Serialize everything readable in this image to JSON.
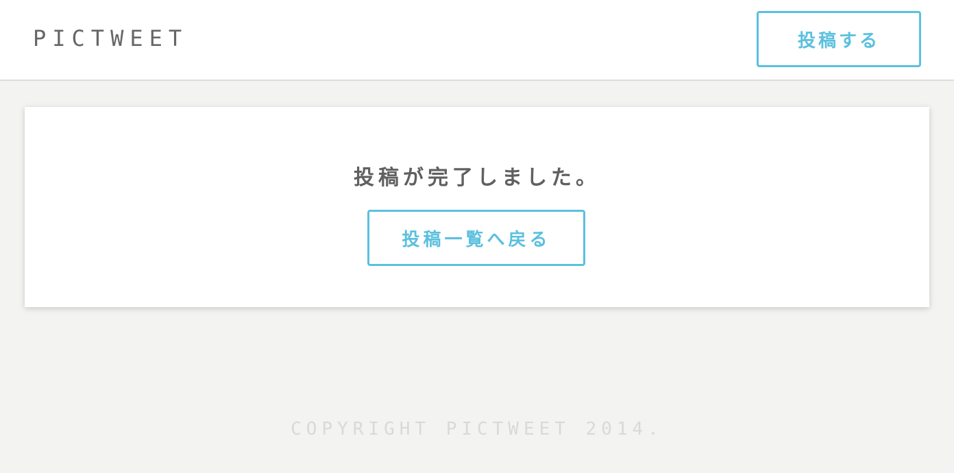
{
  "header": {
    "logo_text": "PICTWEET",
    "post_button_label": "投稿する"
  },
  "main": {
    "message": "投稿が完了しました。",
    "back_button_label": "投稿一覧へ戻る"
  },
  "footer": {
    "copyright": "COPYRIGHT PICTWEET 2014."
  },
  "colors": {
    "accent": "#5bc0de",
    "background": "#f3f3f2",
    "text": "#606060"
  }
}
